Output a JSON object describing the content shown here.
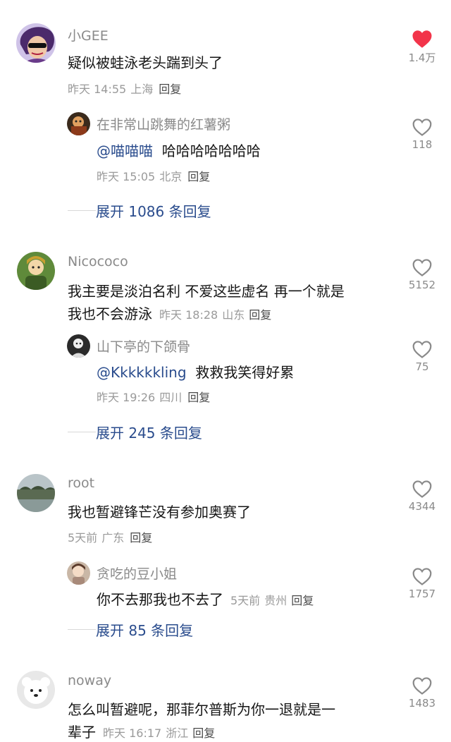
{
  "comments": [
    {
      "user": "小GEE",
      "text": "疑似被蛙泳老头踹到头了",
      "time": "昨天 14:55",
      "location": "上海",
      "reply_label": "回复",
      "likes": "1.4万",
      "liked": true,
      "reply": {
        "user": "在非常山跳舞的红薯粥",
        "mention": "@喵喵喵",
        "text": "哈哈哈哈哈哈哈",
        "time": "昨天 15:05",
        "location": "北京",
        "reply_label": "回复",
        "likes": "118"
      },
      "expand_label": "展开 1086 条回复"
    },
    {
      "user": "Nicococo",
      "text_line1": "我主要是淡泊名利 不爱这些虚名 再一个就是",
      "text_line2": "我也不会游泳",
      "time": "昨天 18:28",
      "location": "山东",
      "reply_label": "回复",
      "likes": "5152",
      "reply": {
        "user": "山下亭的下颌骨",
        "mention": "@Kkkkkkling",
        "text": "救救我笑得好累",
        "time": "昨天 19:26",
        "location": "四川",
        "reply_label": "回复",
        "likes": "75"
      },
      "expand_label": "展开 245 条回复"
    },
    {
      "user": "root",
      "text": "我也暂避锋芒没有参加奥赛了",
      "time": "5天前",
      "location": "广东",
      "reply_label": "回复",
      "likes": "4344",
      "reply": {
        "user": "贪吃的豆小姐",
        "text": "你不去那我也不去了",
        "time": "5天前",
        "location": "贵州",
        "reply_label": "回复",
        "likes": "1757"
      },
      "expand_label": "展开 85 条回复"
    },
    {
      "user": "noway",
      "text_line1": "怎么叫暂避呢，那菲尔普斯为你一退就是一",
      "text_line2": "辈子",
      "time": "昨天 16:17",
      "location": "浙江",
      "reply_label": "回复",
      "likes": "1483"
    }
  ],
  "colors": {
    "liked_heart": "#f2344a",
    "outline_heart": "#8a8a8a",
    "link_blue": "#2a4c8d"
  },
  "icons": [
    "heart-icon-filled",
    "heart-icon-outline"
  ]
}
